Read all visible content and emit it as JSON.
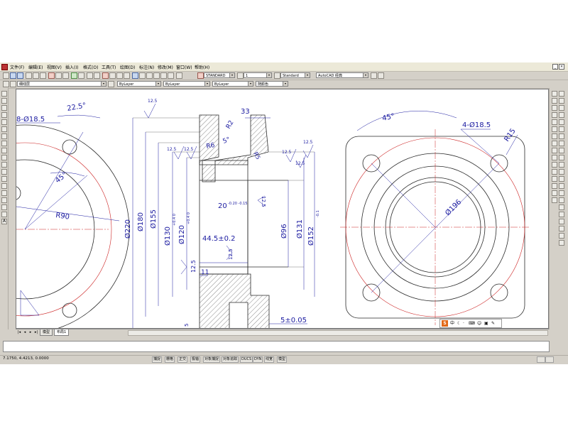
{
  "menu": {
    "items": [
      "文件(F)",
      "编辑(E)",
      "视图(V)",
      "插入(I)",
      "格式(O)",
      "工具(T)",
      "绘图(D)",
      "标注(N)",
      "修改(M)",
      "窗口(W)",
      "帮助(H)"
    ]
  },
  "toolbar": {
    "text_style": "STANDARD",
    "dim_style": "1",
    "table_style": "Standard",
    "workspace": "AutoCAD 经典",
    "layer": "细线层",
    "color": "ByLayer",
    "linetype": "ByLayer",
    "lineweight": "ByLayer",
    "plot_style": "随颜色"
  },
  "drawing": {
    "left_view": {
      "angle1": "22.5°",
      "holes": "8-Ø18.5",
      "angle2": "45°",
      "radius": "R90"
    },
    "section_view": {
      "width_top": "33",
      "r2": "R2",
      "r6": "R6",
      "angle5": "5°",
      "r5": "R5",
      "rough_labels": [
        "12.5",
        "12.5",
        "12.5",
        "12.5",
        "12.5",
        "12.5",
        "12.5",
        "12.5",
        "12.5"
      ],
      "dia_220": "Ø220",
      "dia_180": "Ø180",
      "dia_155": "Ø155",
      "dia_130": "Ø130",
      "dia_130_tol": "+0.4 0",
      "dia_120": "Ø120",
      "dia_120_tol": "+0.4 0",
      "depth_20": "20",
      "depth_20_tol": "-0.20 -0.15",
      "width_44": "44.5±0.2",
      "dia_96": "Ø96",
      "dia_131": "Ø131",
      "dia_152": "Ø152",
      "dia_152_tol": "-0.1",
      "len_11": "11",
      "len_5": "5",
      "len_5_tol": "5±0.05"
    },
    "front_view": {
      "angle": "45°",
      "holes": "4-Ø18.5",
      "radius": "R15",
      "dia_196": "Ø196"
    }
  },
  "tabs": [
    "模型",
    "布局1"
  ],
  "ime_text": "中",
  "status": {
    "coords": "7.1750, 4.4213, 0.0000",
    "buttons": [
      "捕捉",
      "栅格",
      "正交",
      "极轴",
      "对象捕捉",
      "对象追踪",
      "DUCS",
      "DYN",
      "线宽",
      "模型"
    ]
  },
  "colors": {
    "outline": "#2a2a2a",
    "dimension": "#1a1aa0",
    "centerline": "#cc2222",
    "hatch": "#555555"
  }
}
